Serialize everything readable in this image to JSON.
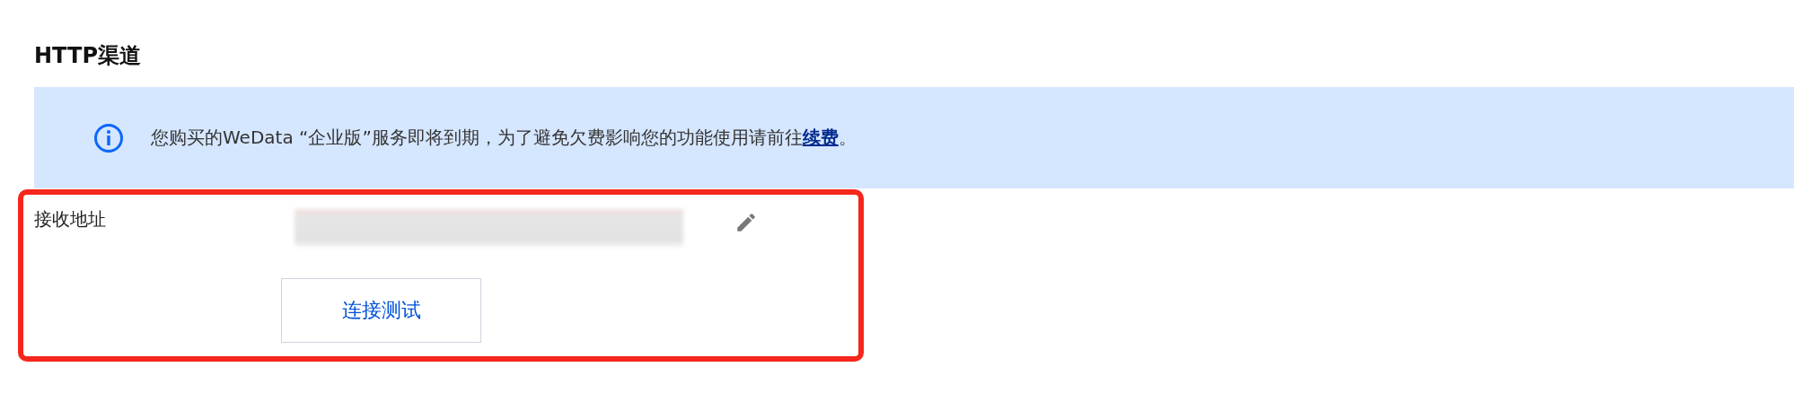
{
  "title": "HTTP渠道",
  "notice": {
    "text": "您购买的WeData “企业版”服务即将到期，为了避免欠费影响您的功能使用请前往",
    "link": "续费",
    "end": "。"
  },
  "form": {
    "label": "接收地址",
    "button": "连接测试"
  }
}
